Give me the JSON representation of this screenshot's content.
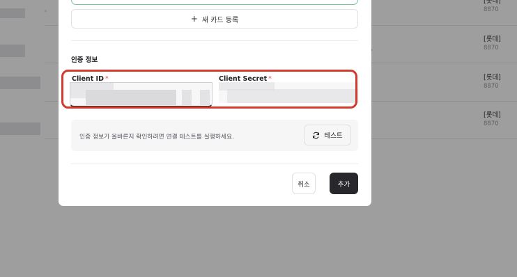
{
  "background": {
    "rows": [
      {
        "brand": "[롯데]",
        "number": "8870"
      },
      {
        "brand": "[롯데]",
        "number": "8870"
      },
      {
        "brand": "[롯데]",
        "number": "8870"
      },
      {
        "brand": "[롯데]",
        "number": "8870"
      }
    ]
  },
  "modal": {
    "add_card_label": "새 카드 등록",
    "add_card_icon": "plus-icon",
    "section_title": "인증 정보",
    "client_id": {
      "label": "Client ID",
      "required_mark": "*"
    },
    "client_secret": {
      "label": "Client Secret",
      "required_mark": "*"
    },
    "test_panel": {
      "message": "인증 정보가 올바른지 확인하려면 연결 테스트를 실행하세요.",
      "button_label": "테스트",
      "button_icon": "refresh-icon"
    },
    "cancel_label": "취소",
    "submit_label": "추가"
  },
  "colors": {
    "highlight": "#d13a2c",
    "primary_button": "#27272c",
    "required": "#e5484d",
    "previous_field_border": "#74c69a"
  }
}
